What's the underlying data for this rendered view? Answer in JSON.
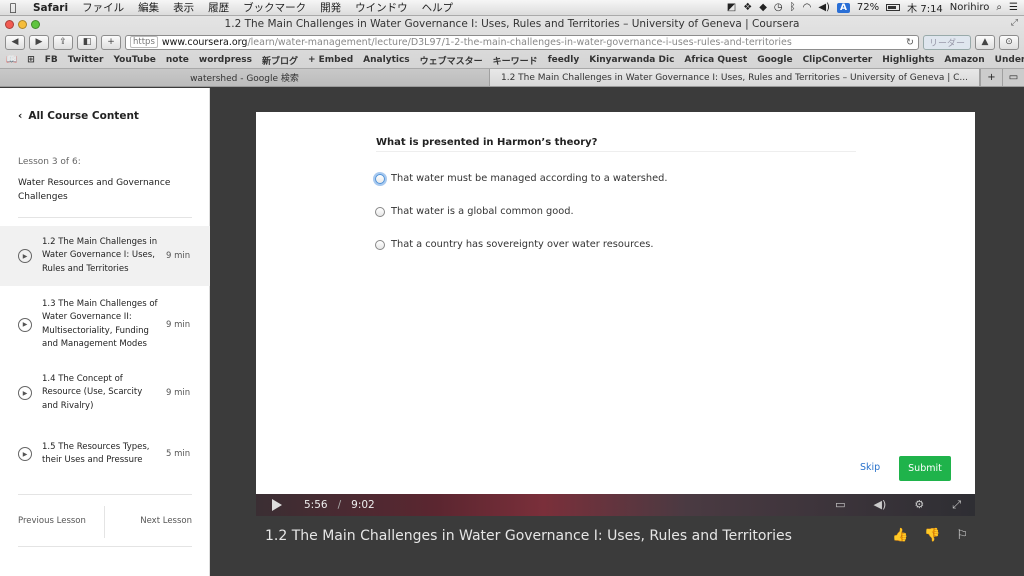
{
  "menubar": {
    "app": "Safari",
    "items": [
      "ファイル",
      "編集",
      "表示",
      "履歴",
      "ブックマーク",
      "開発",
      "ウインドウ",
      "ヘルプ"
    ],
    "input_badge": "A",
    "battery": "72%",
    "clock": "木 7:14",
    "user": "Norihiro"
  },
  "window": {
    "title": "1.2 The Main Challenges in Water Governance I: Uses, Rules and Territories – University of Geneva | Coursera",
    "url_scheme": "https",
    "url_domain": "www.coursera.org",
    "url_path": "/learn/water-management/lecture/D3L97/1-2-the-main-challenges-in-water-governance-i-uses-rules-and-territories",
    "reader": "リーダー",
    "bookmarks": [
      "FB",
      "Twitter",
      "YouTube",
      "note",
      "wordpress",
      "新ブログ",
      "+ Embed",
      "Analytics",
      "ウェブマスター",
      "キーワード",
      "feedly",
      "Kinyarwanda Dic",
      "Africa Quest",
      "Google",
      "ClipConverter",
      "Highlights",
      "Amazon",
      "Undersky"
    ],
    "tabs": [
      {
        "label": "watershed - Google 検索"
      },
      {
        "label": "1.2 The Main Challenges in Water Governance I: Uses, Rules and Territories – University of Geneva | C..."
      }
    ]
  },
  "sidebar": {
    "back_label": "All Course Content",
    "lesson_of": "Lesson 3 of 6:",
    "lesson_title": "Water Resources and Governance Challenges",
    "items": [
      {
        "label": "1.2 The Main Challenges in Water Governance I: Uses, Rules and Territories",
        "duration": "9 min"
      },
      {
        "label": "1.3 The Main Challenges of Water Governance II: Multisectoriality, Funding and Management Modes",
        "duration": "9 min"
      },
      {
        "label": "1.4 The Concept of Resource (Use, Scarcity and Rivalry)",
        "duration": "9 min"
      },
      {
        "label": "1.5 The Resources Types, their Uses and Pressure",
        "duration": "5 min"
      }
    ],
    "prev": "Previous Lesson",
    "next": "Next Lesson"
  },
  "quiz": {
    "question": "What is presented in Harmon’s theory?",
    "options": [
      "That water must be managed according to a watershed.",
      "That water is a global common good.",
      "That a country has sovereignty over water resources."
    ],
    "skip": "Skip",
    "submit": "Submit"
  },
  "player": {
    "current": "5:56",
    "separator": "/",
    "total": "9:02",
    "title": "1.2 The Main Challenges in Water Governance I: Uses, Rules and Territories"
  }
}
